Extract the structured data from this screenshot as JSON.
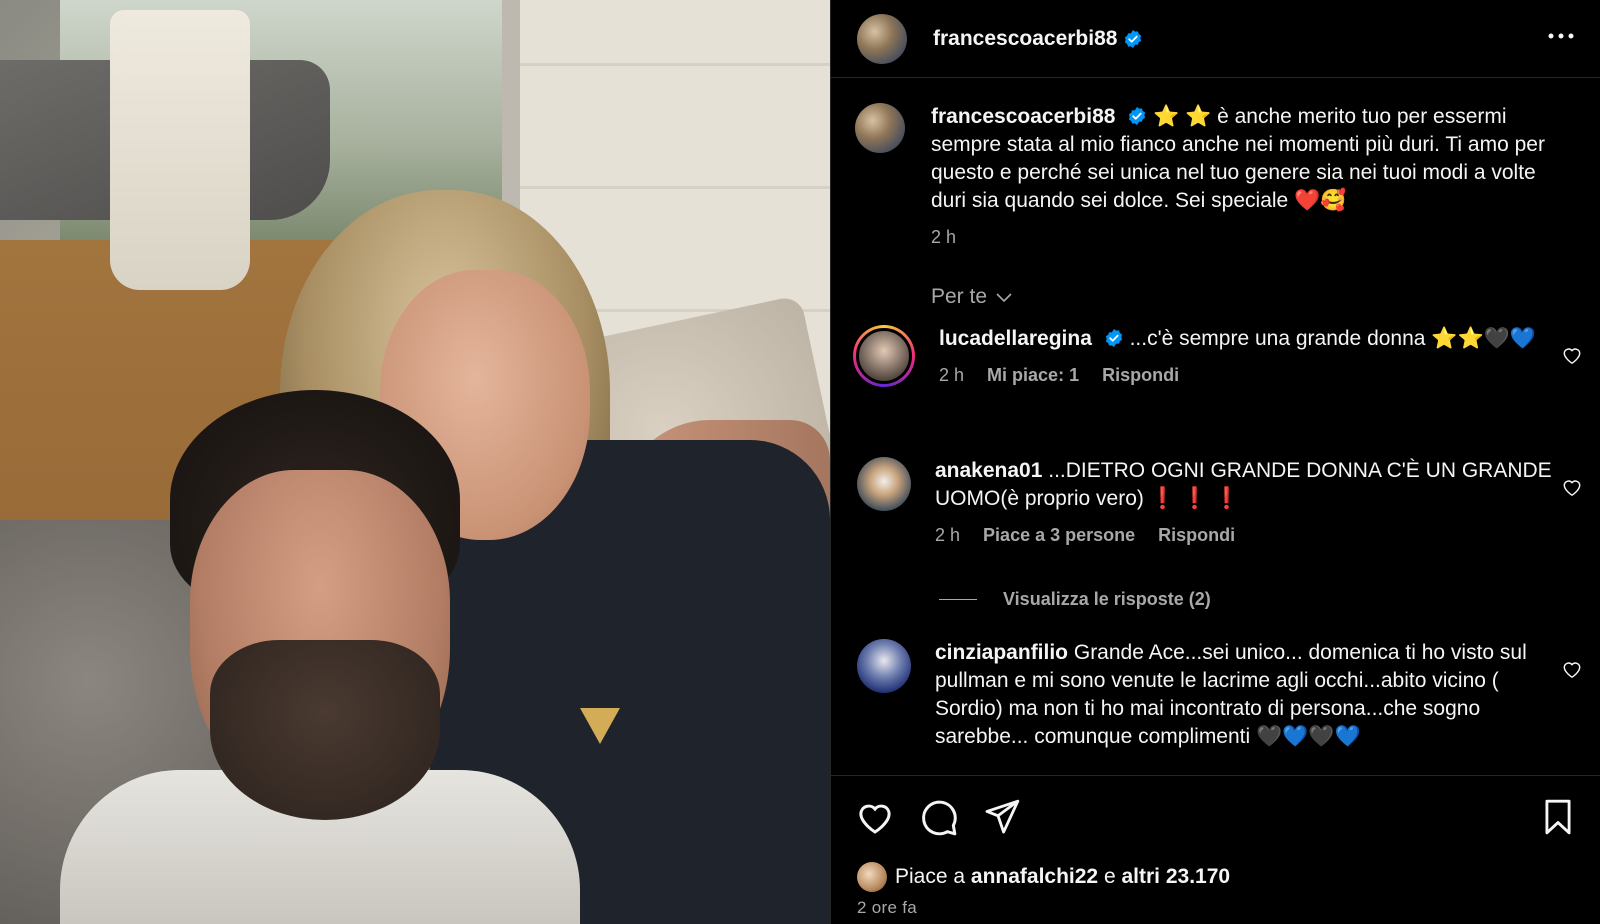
{
  "post": {
    "author": "francescoacerbi88"
  },
  "caption": {
    "username": "francescoacerbi88",
    "text": "⭐ ⭐ è anche merito tuo per essermi sempre stata al mio fianco anche nei momenti più duri. Ti amo per questo e perché sei unica nel tuo genere sia nei tuoi modi a volte duri sia quando sei dolce. Sei speciale ❤️🥰",
    "time": "2 h"
  },
  "filter": {
    "label": "Per te"
  },
  "comments": [
    {
      "username": "lucadellaregina",
      "verified": true,
      "text": "...c'è sempre una grande donna ⭐⭐🖤💙",
      "time": "2 h",
      "likes": "Mi piace: 1",
      "reply": "Rispondi"
    },
    {
      "username": "anakena01",
      "verified": false,
      "text": "...DIETRO OGNI GRANDE DONNA C'È UN GRANDE UOMO(è proprio vero) ❗ ❗ ❗",
      "time": "2 h",
      "likes": "Piace a 3 persone",
      "reply": "Rispondi"
    },
    {
      "username": "cinziapanfilio",
      "verified": false,
      "text": "Grande Ace...sei unico... domenica ti ho visto sul pullman e mi sono venute le lacrime agli occhi...abito vicino ( Sordio) ma non ti ho mai incontrato di persona...che sogno sarebbe... comunque complimenti 🖤💙🖤💙"
    }
  ],
  "view_replies": "Visualizza le risposte (2)",
  "likes_line": {
    "prefix": "Piace a",
    "user": "annafalchi22",
    "joiner": "e",
    "others": "altri 23.170"
  },
  "posted_ago": "2 ore fa",
  "colors": {
    "background": "#000000",
    "text": "#f5f5f5",
    "muted": "#a8a8a8",
    "verified": "#0095f6",
    "divider": "#262626"
  }
}
